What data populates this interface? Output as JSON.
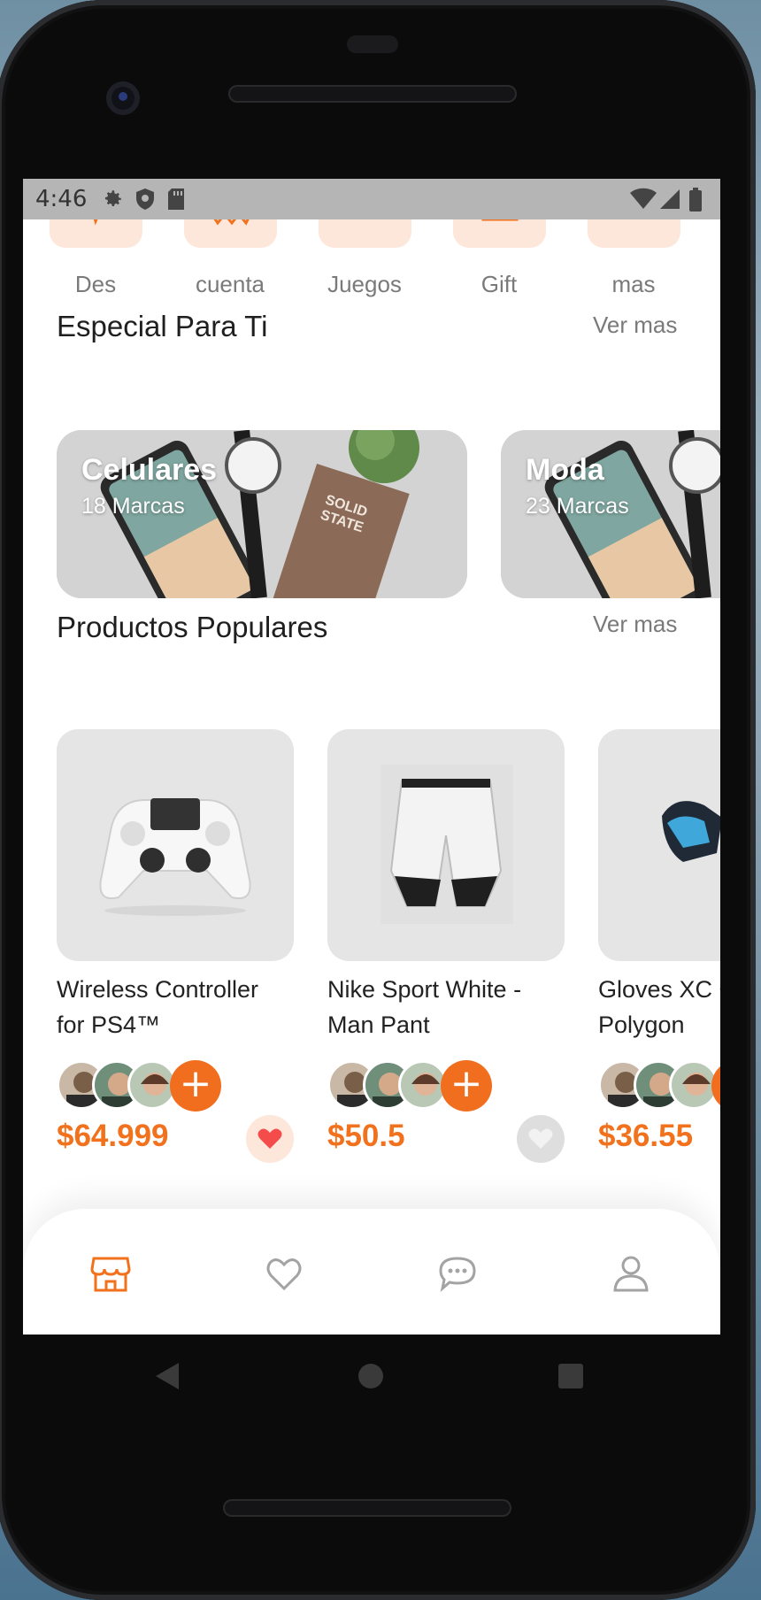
{
  "status_bar": {
    "time": "4:46"
  },
  "categories": [
    {
      "label": "Des"
    },
    {
      "label": "cuenta"
    },
    {
      "label": "Juegos"
    },
    {
      "label": "Gift"
    },
    {
      "label": "mas"
    }
  ],
  "special": {
    "title": "Especial Para Ti",
    "see_more": "Ver mas",
    "banners": [
      {
        "title": "Celulares",
        "subtitle": "18 Marcas"
      },
      {
        "title": "Moda",
        "subtitle": "23 Marcas"
      }
    ]
  },
  "popular": {
    "title": "Productos Populares",
    "see_more": "Ver mas",
    "products": [
      {
        "name": "Wireless Controller for PS4™",
        "price": "$64.999",
        "favorite": true
      },
      {
        "name": "Nike Sport White - Man Pant",
        "price": "$50.5",
        "favorite": false
      },
      {
        "name": "Gloves XC Omega - Polygon",
        "price": "$36.55",
        "favorite": false
      }
    ],
    "add_symbol": "+"
  },
  "bottom_nav": {
    "items": [
      "shop-icon",
      "heart-icon",
      "chat-icon",
      "user-icon"
    ],
    "active": "shop-icon"
  },
  "colors": {
    "accent": "#F2711C",
    "tile": "#FDE7DA",
    "fav_active_bg": "#FDE7DA",
    "heart_red": "#F44B4B"
  }
}
